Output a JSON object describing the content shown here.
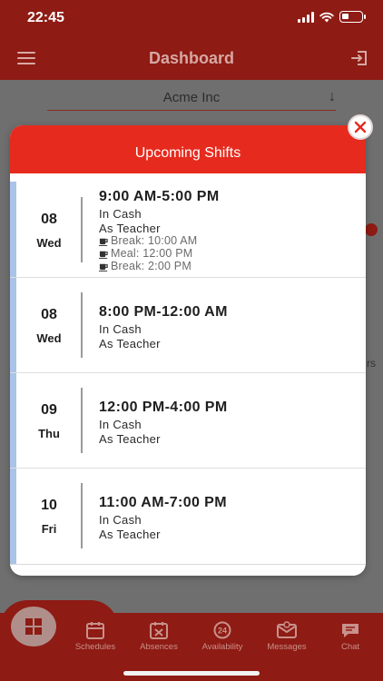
{
  "status_bar": {
    "time": "22:45"
  },
  "app_bar": {
    "title": "Dashboard"
  },
  "company": {
    "name": "Acme Inc",
    "arrow": "↓"
  },
  "background": {
    "partial_text": "rs"
  },
  "modal": {
    "title": "Upcoming Shifts",
    "shifts": [
      {
        "day": "08",
        "dow": "Wed",
        "time": "9:00 AM-5:00 PM",
        "location": "In Cash",
        "role": "As Teacher",
        "breaks": [
          "Break: 10:00 AM",
          "Meal: 12:00 PM",
          "Break: 2:00 PM"
        ]
      },
      {
        "day": "08",
        "dow": "Wed",
        "time": "8:00 PM-12:00 AM",
        "location": "In Cash",
        "role": "As Teacher"
      },
      {
        "day": "09",
        "dow": "Thu",
        "time": "12:00 PM-4:00 PM",
        "location": "In Cash",
        "role": "As Teacher"
      },
      {
        "day": "10",
        "dow": "Fri",
        "time": "11:00 AM-7:00 PM",
        "location": "In Cash",
        "role": "As Teacher"
      }
    ]
  },
  "tabs": {
    "schedules": "Schedules",
    "absences": "Absences",
    "availability": "Availability",
    "availability_badge": "24",
    "messages": "Messages",
    "chat": "Chat"
  },
  "colors": {
    "brand_dark": "#8e1b14",
    "header_red": "#e62b1e",
    "accent_blue": "#aac3e8"
  }
}
